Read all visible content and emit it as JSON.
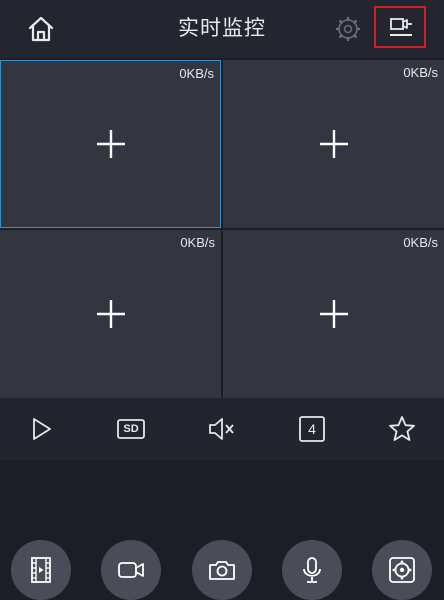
{
  "header": {
    "title": "实时监控"
  },
  "panes": [
    {
      "rate": "0KB/s"
    },
    {
      "rate": "0KB/s"
    },
    {
      "rate": "0KB/s"
    },
    {
      "rate": "0KB/s"
    }
  ],
  "controls": {
    "sd_label": "SD",
    "split_count": "4"
  },
  "icons": {
    "home": "home-icon",
    "settings": "gear-icon",
    "layout": "layout-switch-icon",
    "add": "plus-icon",
    "play": "play-icon",
    "sd": "sd-quality-icon",
    "mute": "speaker-muted-icon",
    "split": "split-screen-icon",
    "favorite": "star-icon",
    "playback": "film-icon",
    "record": "video-camera-icon",
    "snapshot": "camera-icon",
    "talk": "microphone-icon",
    "ptz": "ptz-icon"
  },
  "colors": {
    "background": "#22252e",
    "pane": "#333640",
    "selected_border": "#3b8fc4",
    "highlight_box": "#d0202a",
    "round_button": "#4a4d58"
  }
}
